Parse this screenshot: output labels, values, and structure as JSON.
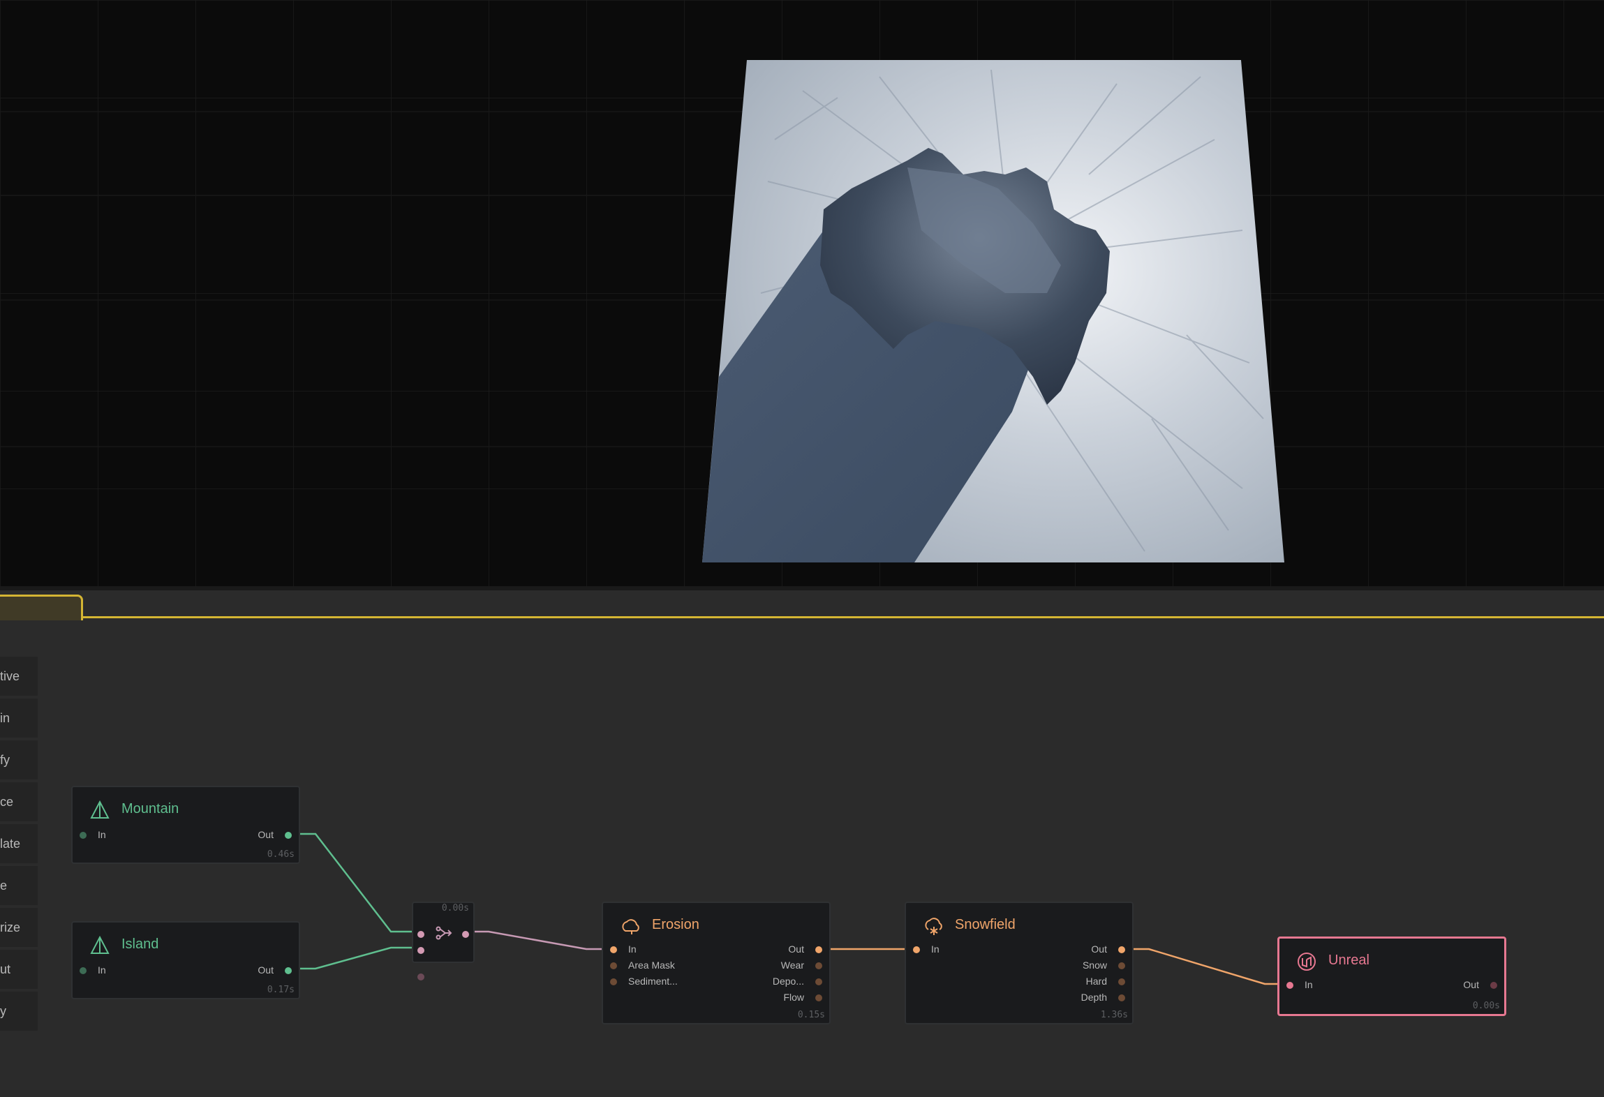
{
  "sidebar": {
    "items": [
      "tive",
      "in",
      "fy",
      "ce",
      "late",
      "e",
      "rize",
      "ut",
      "y"
    ]
  },
  "nodes": {
    "mountain": {
      "title": "Mountain",
      "in": "In",
      "out": "Out",
      "timing": "0.46s",
      "icon": "mountain-icon"
    },
    "island": {
      "title": "Island",
      "in": "In",
      "out": "Out",
      "timing": "0.17s",
      "icon": "island-icon"
    },
    "combine": {
      "timing": "0.00s",
      "icon": "combine-icon"
    },
    "erosion": {
      "title": "Erosion",
      "inputs": [
        "In",
        "Area Mask",
        "Sediment..."
      ],
      "outputs": [
        "Out",
        "Wear",
        "Depo...",
        "Flow"
      ],
      "timing": "0.15s",
      "icon": "erosion-icon"
    },
    "snowfield": {
      "title": "Snowfield",
      "inputs": [
        "In"
      ],
      "outputs": [
        "Out",
        "Snow",
        "Hard",
        "Depth"
      ],
      "timing": "1.36s",
      "icon": "snowfield-icon"
    },
    "unreal": {
      "title": "Unreal",
      "in": "In",
      "out": "Out",
      "timing": "0.00s",
      "icon": "unreal-icon"
    }
  },
  "colors": {
    "green": "#5fbf8f",
    "orange": "#f0a56a",
    "pink": "#e77891",
    "mauve": "#c79ab4",
    "accent_tab": "#d4b533"
  }
}
